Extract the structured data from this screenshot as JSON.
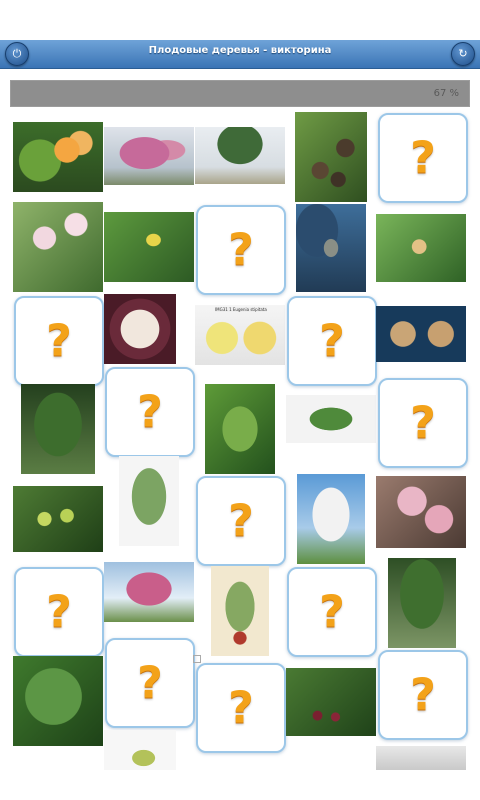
{
  "app": {
    "title": "Плодовые деревья - викторина",
    "progress_label": "67 %"
  },
  "buttons": {
    "power_icon": "⏻",
    "refresh_icon": "↻"
  },
  "cards": {
    "question_mark": "?",
    "photo_caption": "IMG31 1 Eugenia stipitata"
  },
  "colors": {
    "appbar": "#3a74b5",
    "card_border": "#9cc7e8",
    "question": "#f3a219",
    "progress": "#8e8e8e"
  }
}
